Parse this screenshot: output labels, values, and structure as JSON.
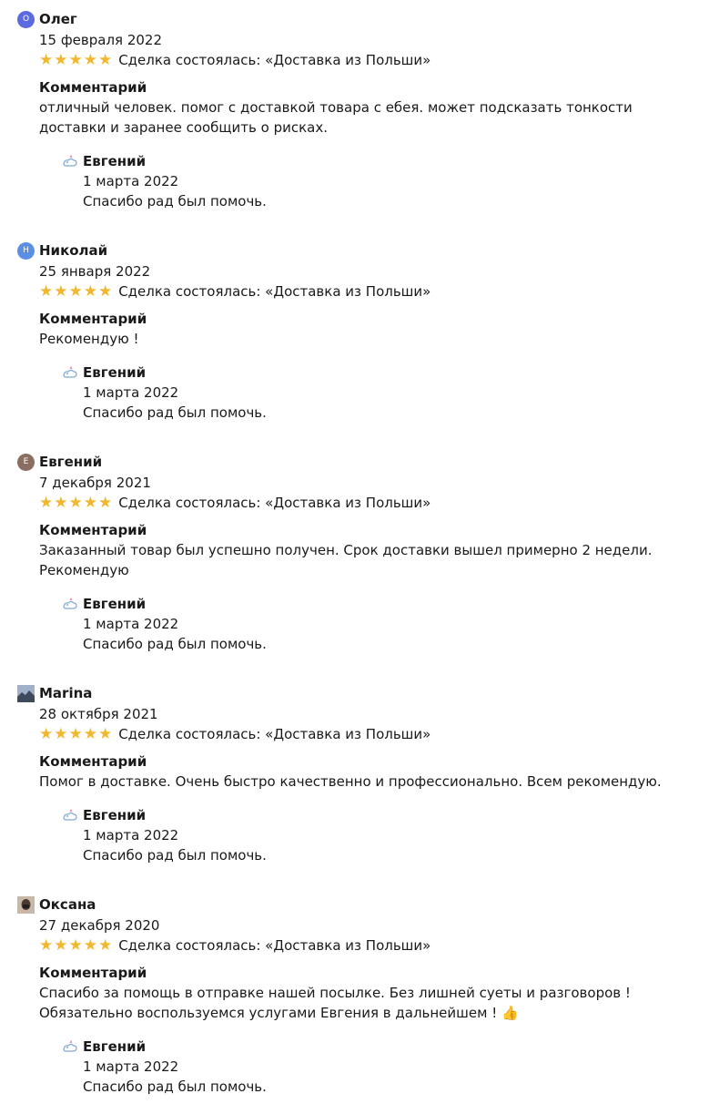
{
  "common": {
    "stars": "★★★★★",
    "comment_label": "Комментарий"
  },
  "reviews": [
    {
      "author": "Олег",
      "avatar_letter": "О",
      "avatar_color": "#5b6ae0",
      "date": "15 февраля 2022",
      "deal": "Сделка состоялась: «Доставка из Польши»",
      "comment": "отличный человек. помог с доставкой товара с ебея. может подсказать тонкости доставки и заранее сообщить о рисках.",
      "reply": {
        "author": "Евгений",
        "date": "1 марта 2022",
        "text": "Спасибо рад был помочь."
      }
    },
    {
      "author": "Николай",
      "avatar_letter": "Н",
      "avatar_color": "#5b8fe6",
      "date": "25 января 2022",
      "deal": "Сделка состоялась: «Доставка из Польши»",
      "comment": "Рекомендую !",
      "reply": {
        "author": "Евгений",
        "date": "1 марта 2022",
        "text": "Спасибо рад был помочь."
      }
    },
    {
      "author": "Евгений",
      "avatar_letter": "Е",
      "avatar_color": "#8a6e62",
      "date": "7 декабря 2021",
      "deal": "Сделка состоялась: «Доставка из Польши»",
      "comment": "Заказанный товар был успешно получен. Срок доставки вышел примерно 2 недели. Рекомендую",
      "reply": {
        "author": "Евгений",
        "date": "1 марта 2022",
        "text": "Спасибо рад был помочь."
      }
    },
    {
      "author": "Marina",
      "avatar_letter": "",
      "avatar_color": "#6b7d96",
      "date": "28 октября 2021",
      "deal": "Сделка состоялась: «Доставка из Польши»",
      "comment": "Помог в доставке. Очень быстро качественно и профессионально. Всем рекомендую.",
      "reply": {
        "author": "Евгений",
        "date": "1 марта 2022",
        "text": "Спасибо рад был помочь."
      }
    },
    {
      "author": "Оксана",
      "avatar_letter": "",
      "avatar_color": "#6a5448",
      "date": "27 декабря 2020",
      "deal": "Сделка состоялась: «Доставка из Польши»",
      "comment": "Спасибо за помощь в отправке нашей посылке. Без лишней суеты и разговоров ! Обязательно воспользуемся услугами Евгения в дальнейшем ! 👍",
      "reply": {
        "author": "Евгений",
        "date": "1 марта 2022",
        "text": "Спасибо рад был помочь."
      }
    }
  ]
}
